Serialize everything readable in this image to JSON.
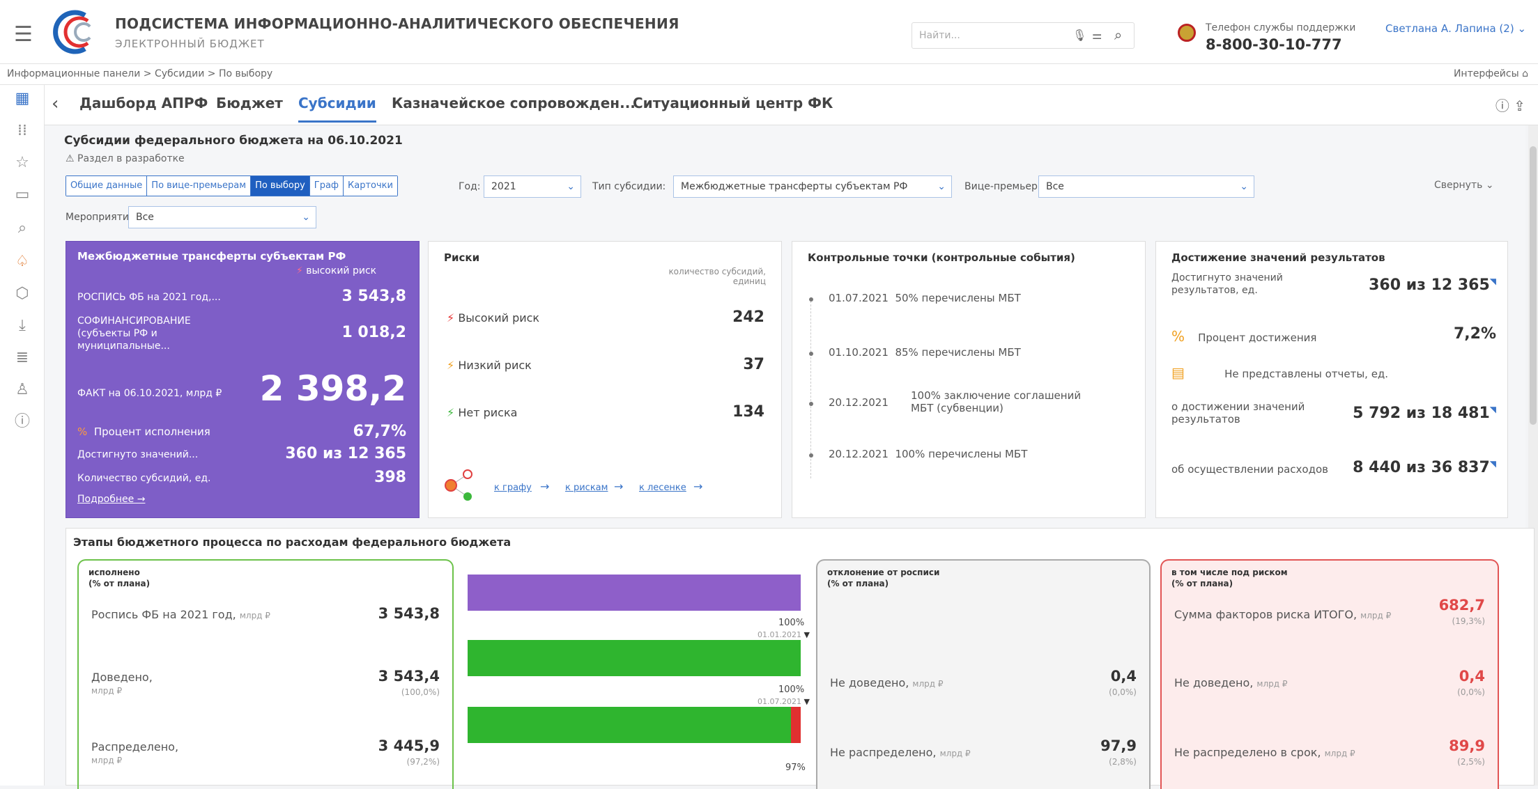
{
  "header": {
    "title": "ПОДСИСТЕМА ИНФОРМАЦИОННО-АНАЛИТИЧЕСКОГО ОБЕСПЕЧЕНИЯ",
    "subtitle": "ЭЛЕКТРОННЫЙ БЮДЖЕТ",
    "search_placeholder": "Найти...",
    "support_label": "Телефон службы поддержки",
    "support_phone": "8-800-30-10-777",
    "user": "Светлана А. Лапина (2)"
  },
  "breadcrumb": "Информационные панели > Субсидии > По выбору",
  "interfaces": "Интерфейсы",
  "tabs": [
    "Дашборд АПРФ",
    "Бюджет",
    "Субсидии",
    "Казначейское сопровожден...",
    "Ситуационный центр ФК"
  ],
  "page": {
    "title": "Субсидии федерального бюджета на 06.10.2021",
    "dev": "Раздел в разработке",
    "segments": [
      "Общие данные",
      "По вице-премьерам",
      "По выбору",
      "Граф",
      "Карточки"
    ],
    "year_label": "Год:",
    "year": "2021",
    "type_label": "Тип субсидии:",
    "type": "Межбюджетные трансферты субъектам РФ",
    "vp_label": "Вице-премьер:",
    "vp": "Все",
    "events_label": "Мероприятия:",
    "events": "Все",
    "collapse": "Свернуть"
  },
  "purple": {
    "title": "Межбюджетные трансферты субъектам РФ",
    "risk": "высокий риск",
    "r1_label": "РОСПИСЬ ФБ на 2021 год,...",
    "r1_value": "3 543,8",
    "r2_label1": "СОФИНАНСИРОВАНИЕ",
    "r2_label2": "(субъекты РФ и",
    "r2_label3": "муниципальные...",
    "r2_value": "1 018,2",
    "fact_label": "ФАКТ на 06.10.2021, млрд ₽",
    "fact_value": "2 398,2",
    "pct_label": "Процент исполнения",
    "pct_value": "67,7%",
    "ach_label": "Достигнуто значений...",
    "ach_value": "360 из 12 365",
    "cnt_label": "Количество субсидий, ед.",
    "cnt_value": "398",
    "more": "Подробнее →"
  },
  "risks": {
    "title": "Риски",
    "hint1": "количество субсидий,",
    "hint2": "единиц",
    "high_label": "Высокий риск",
    "high_value": "242",
    "low_label": "Низкий риск",
    "low_value": "37",
    "none_label": "Нет риска",
    "none_value": "134",
    "link1": "к графу",
    "link2": "к рискам",
    "link3": "к лесенке"
  },
  "control": {
    "title": "Контрольные точки (контрольные события)",
    "items": [
      {
        "date": "01.07.2021",
        "text": "50% перечислены МБТ"
      },
      {
        "date": "01.10.2021",
        "text": "85% перечислены МБТ"
      },
      {
        "date": "20.12.2021",
        "text1": "100% заключение соглашений",
        "text2": "МБТ (субвенции)"
      },
      {
        "date": "20.12.2021",
        "text": "100% перечислены МБТ"
      }
    ]
  },
  "achieve": {
    "title": "Достижение значений результатов",
    "l1a": "Достигнуто значений",
    "l1b": "результатов, ед.",
    "v1": "360 из 12 365",
    "l2": "Процент достижения",
    "v2": "7,2%",
    "l3": "Не представлены отчеты, ед.",
    "l4a": "о достижении значений",
    "l4b": "результатов",
    "v4": "5 792 из 18 481",
    "l5": "об осуществлении расходов",
    "v5": "8 440 из 36 837"
  },
  "stages": {
    "title": "Этапы бюджетного процесса по расходам федерального бюджета",
    "done_h1": "исполнено",
    "done_h2": "(% от плана)",
    "row1_label": "Роспись ФБ на 2021 год,",
    "row1_unit": "млрд ₽",
    "row1_value": "3 543,8",
    "row2_label": "Доведено,",
    "row2_unit": "млрд ₽",
    "row2_value": "3 543,4",
    "row2_pct": "(100,0%)",
    "row3_label": "Распределено,",
    "row3_unit": "млрд ₽",
    "row3_value": "3 445,9",
    "row3_pct": "(97,2%)",
    "bar_pct1": "100%",
    "bar_date1": "01.01.2021",
    "bar_pct2": "100%",
    "bar_date2": "01.07.2021",
    "bar_pct3": "97%",
    "dev_h1": "отклонение от росписи",
    "dev_h2": "(% от плана)",
    "dev1_label": "Не доведено,",
    "dev1_unit": "млрд ₽",
    "dev1_value": "0,4",
    "dev1_pct": "(0,0%)",
    "dev2_label": "Не распределено,",
    "dev2_unit": "млрд ₽",
    "dev2_value": "97,9",
    "dev2_pct": "(2,8%)",
    "risk_h1": "в том числе под риском",
    "risk_h2": "(% от плана)",
    "risk1_label": "Сумма факторов риска ИТОГО,",
    "risk1_unit": "млрд ₽",
    "risk1_value": "682,7",
    "risk1_pct": "(19,3%)",
    "risk2_label": "Не доведено,",
    "risk2_unit": "млрд ₽",
    "risk2_value": "0,4",
    "risk2_pct": "(0,0%)",
    "risk3_label": "Не распределено в срок,",
    "risk3_unit": "млрд ₽",
    "risk3_value": "89,9",
    "risk3_pct": "(2,5%)"
  },
  "colors": {
    "accent": "#3a74c8",
    "purple": "#7e5ec7",
    "green": "#2fb52f",
    "red": "#e04848",
    "bar_purple": "#8e5fc9"
  }
}
